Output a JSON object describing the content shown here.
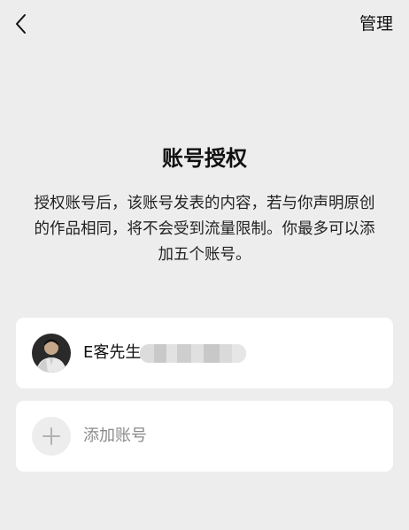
{
  "header": {
    "back_icon": "chevron-left-icon",
    "manage_label": "管理"
  },
  "main": {
    "title": "账号授权",
    "description": "授权账号后，该账号发表的内容，若与你声明原创的作品相同，将不会受到流量限制。你最多可以添加五个账号。"
  },
  "accounts": [
    {
      "name": "E客先生",
      "avatar_icon": "user-avatar-icon"
    }
  ],
  "add_account": {
    "icon": "plus-icon",
    "label": "添加账号"
  },
  "colors": {
    "background": "#ededed",
    "card": "#ffffff",
    "text_primary": "#111111",
    "text_secondary": "#8a8a8a"
  }
}
